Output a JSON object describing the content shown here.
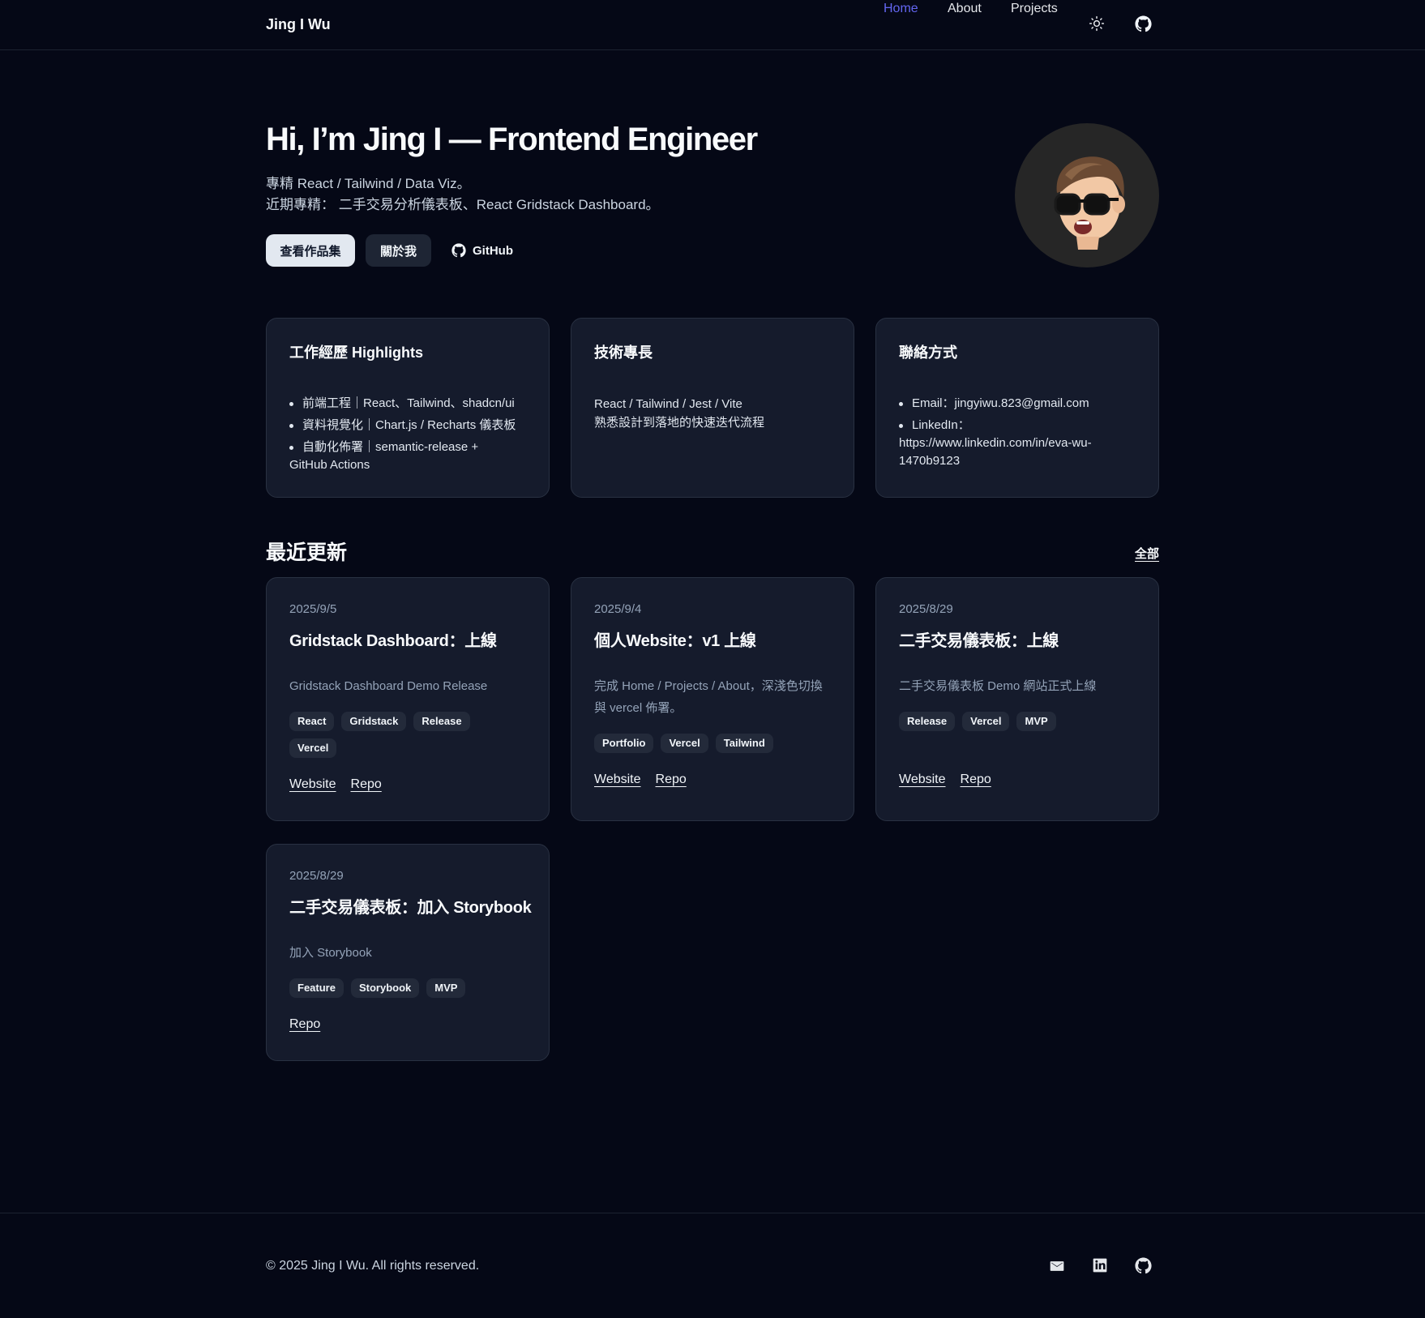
{
  "header": {
    "brand": "Jing I Wu",
    "nav": [
      {
        "label": "Home",
        "active": true
      },
      {
        "label": "About",
        "active": false
      },
      {
        "label": "Projects",
        "active": false
      }
    ],
    "icons": [
      "sun-icon",
      "github-icon"
    ]
  },
  "hero": {
    "title": "Hi, I’m Jing I — Frontend Engineer",
    "subtitle_1": "專精 React / Tailwind / Data Viz。",
    "subtitle_2": "近期專精： 二手交易分析儀表板、React Gridstack Dashboard。",
    "buttons": {
      "portfolio": "查看作品集",
      "about": "關於我",
      "github": "GitHub"
    }
  },
  "cards": {
    "experience": {
      "title": "工作經歷 Highlights",
      "items": [
        "前端工程｜React、Tailwind、shadcn/ui",
        "資料視覺化｜Chart.js / Recharts 儀表板",
        "自動化佈署｜semantic-release +",
        "GitHub Actions"
      ]
    },
    "skills": {
      "title": "技術專長",
      "line_1": "React / Tailwind / Jest / Vite",
      "line_2": "熟悉設計到落地的快速迭代流程"
    },
    "contact": {
      "title": "聯絡方式",
      "email": "Email：jingyiwu.823@gmail.com",
      "linkedin_label": "LinkedIn：",
      "linkedin_url_1": "https://www.linkedin.com/in/eva-wu-",
      "linkedin_url_2": "1470b9123"
    }
  },
  "updates": {
    "title": "最近更新",
    "all_link": "全部",
    "items": [
      {
        "date": "2025/9/5",
        "title": "Gridstack Dashboard：上線",
        "desc": "Gridstack Dashboard Demo Release",
        "tags": [
          "React",
          "Gridstack",
          "Release",
          "Vercel"
        ],
        "website": "Website",
        "repo": "Repo"
      },
      {
        "date": "2025/9/4",
        "title": "個人Website：v1 上線",
        "desc": "完成 Home / Projects / About，深淺色切換與 vercel 佈署。",
        "tags": [
          "Portfolio",
          "Vercel",
          "Tailwind"
        ],
        "website": "Website",
        "repo": "Repo"
      },
      {
        "date": "2025/8/29",
        "title": "二手交易儀表板：上線",
        "desc": "二手交易儀表板 Demo 網站正式上線",
        "tags": [
          "Release",
          "Vercel",
          "MVP"
        ],
        "website": "Website",
        "repo": "Repo"
      },
      {
        "date": "2025/8/29",
        "title": "二手交易儀表板：加入 Storybook",
        "desc": "加入 Storybook",
        "tags": [
          "Feature",
          "Storybook",
          "MVP"
        ],
        "repo": "Repo"
      }
    ]
  },
  "footer": {
    "copyright": "© 2025 Jing I Wu. All rights reserved.",
    "icons": [
      "mail-icon",
      "linkedin-icon",
      "github-icon"
    ]
  },
  "colors": {
    "background": "#050816",
    "card": "#151b2c",
    "accent": "#6366f1"
  }
}
